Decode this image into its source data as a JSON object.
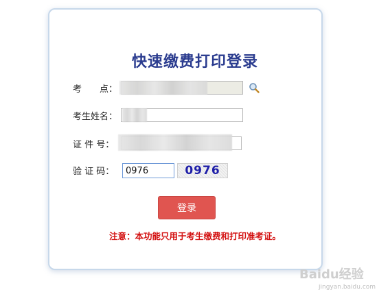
{
  "form": {
    "title": "快速缴费打印登录",
    "fields": {
      "exam_site_label": "考　　点：",
      "name_label": "考生姓名：",
      "id_label": "证 件 号：",
      "captcha_label": "验 证 码："
    },
    "captcha_value": "0976",
    "captcha_image_text": "0976",
    "login_label": "登录",
    "notice": "注意：本功能只用于考生缴费和打印准考证。"
  },
  "icons": {
    "search": "search-icon"
  },
  "watermark": {
    "brand": "Baidu经验",
    "url": "jingyan.baidu.com"
  },
  "colors": {
    "title": "#2b3c8f",
    "button": "#e05550",
    "notice": "#d31010",
    "captcha_text": "#1e1ea8"
  }
}
